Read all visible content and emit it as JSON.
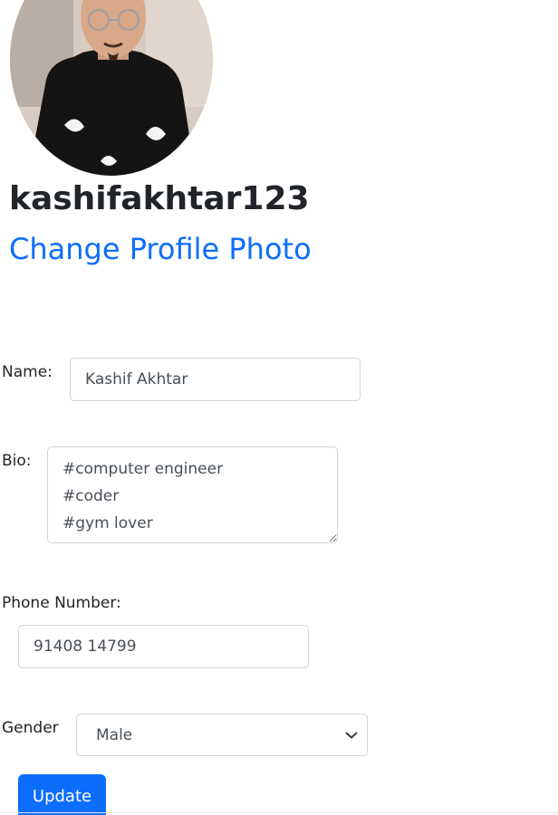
{
  "profile": {
    "username": "kashifakhtar123",
    "change_photo_label": "Change Profile Photo",
    "avatar": "profile-photo"
  },
  "form": {
    "name": {
      "label": "Name:",
      "value": "Kashif Akhtar"
    },
    "bio": {
      "label": "Bio:",
      "value": "#computer engineer\n#coder\n#gym lover"
    },
    "phone": {
      "label": "Phone Number:",
      "value": "91408 14799"
    },
    "gender": {
      "label": "Gender",
      "selected": "Male",
      "icon": "chevron-down-icon"
    },
    "submit_label": "Update"
  },
  "colors": {
    "accent": "#0d6efd",
    "text": "#212529",
    "input_text": "#495057",
    "border": "#ced4da"
  }
}
